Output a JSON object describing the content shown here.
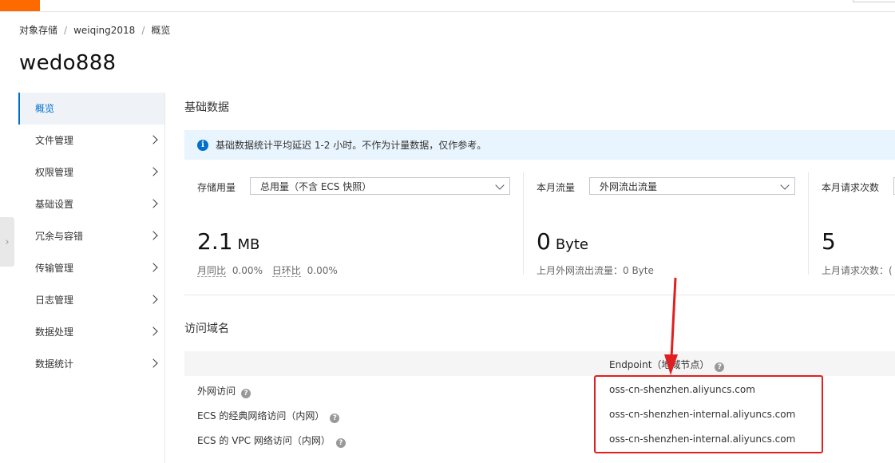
{
  "breadcrumb": {
    "root": "对象存储",
    "bucket": "weiqing2018",
    "current": "概览",
    "sep": "/"
  },
  "page_title": "wedo888",
  "sidebar": {
    "items": [
      {
        "label": "概览"
      },
      {
        "label": "文件管理"
      },
      {
        "label": "权限管理"
      },
      {
        "label": "基础设置"
      },
      {
        "label": "冗余与容错"
      },
      {
        "label": "传输管理"
      },
      {
        "label": "日志管理"
      },
      {
        "label": "数据处理"
      },
      {
        "label": "数据统计"
      }
    ]
  },
  "basic": {
    "title": "基础数据",
    "notice": "基础数据统计平均延迟 1-2 小时。不作为计量数据，仅作参考。",
    "notice_icon": "i",
    "storage": {
      "label": "存储用量",
      "select": "总用量（不含 ECS 快照）",
      "value": "2.1",
      "unit": "MB",
      "mom_label": "月同比",
      "mom_value": "0.00%",
      "dod_label": "日环比",
      "dod_value": "0.00%"
    },
    "traffic": {
      "label": "本月流量",
      "select": "外网流出流量",
      "value": "0",
      "unit": "Byte",
      "foot": "上月外网流出流量：0 Byte"
    },
    "requests": {
      "label": "本月请求次数",
      "value": "5",
      "foot": "上月请求次数：("
    }
  },
  "domains": {
    "title": "访问域名",
    "header": "Endpoint（地域节点）",
    "help_glyph": "?",
    "rows": [
      {
        "name": "外网访问",
        "endpoint": "oss-cn-shenzhen.aliyuncs.com"
      },
      {
        "name": "ECS 的经典网络访问（内网）",
        "endpoint": "oss-cn-shenzhen-internal.aliyuncs.com"
      },
      {
        "name": "ECS 的 VPC 网络访问（内网）",
        "endpoint": "oss-cn-shenzhen-internal.aliyuncs.com"
      }
    ]
  },
  "colors": {
    "accent": "#0070cc",
    "brand": "#ff6a00",
    "annotation": "#e02020"
  }
}
